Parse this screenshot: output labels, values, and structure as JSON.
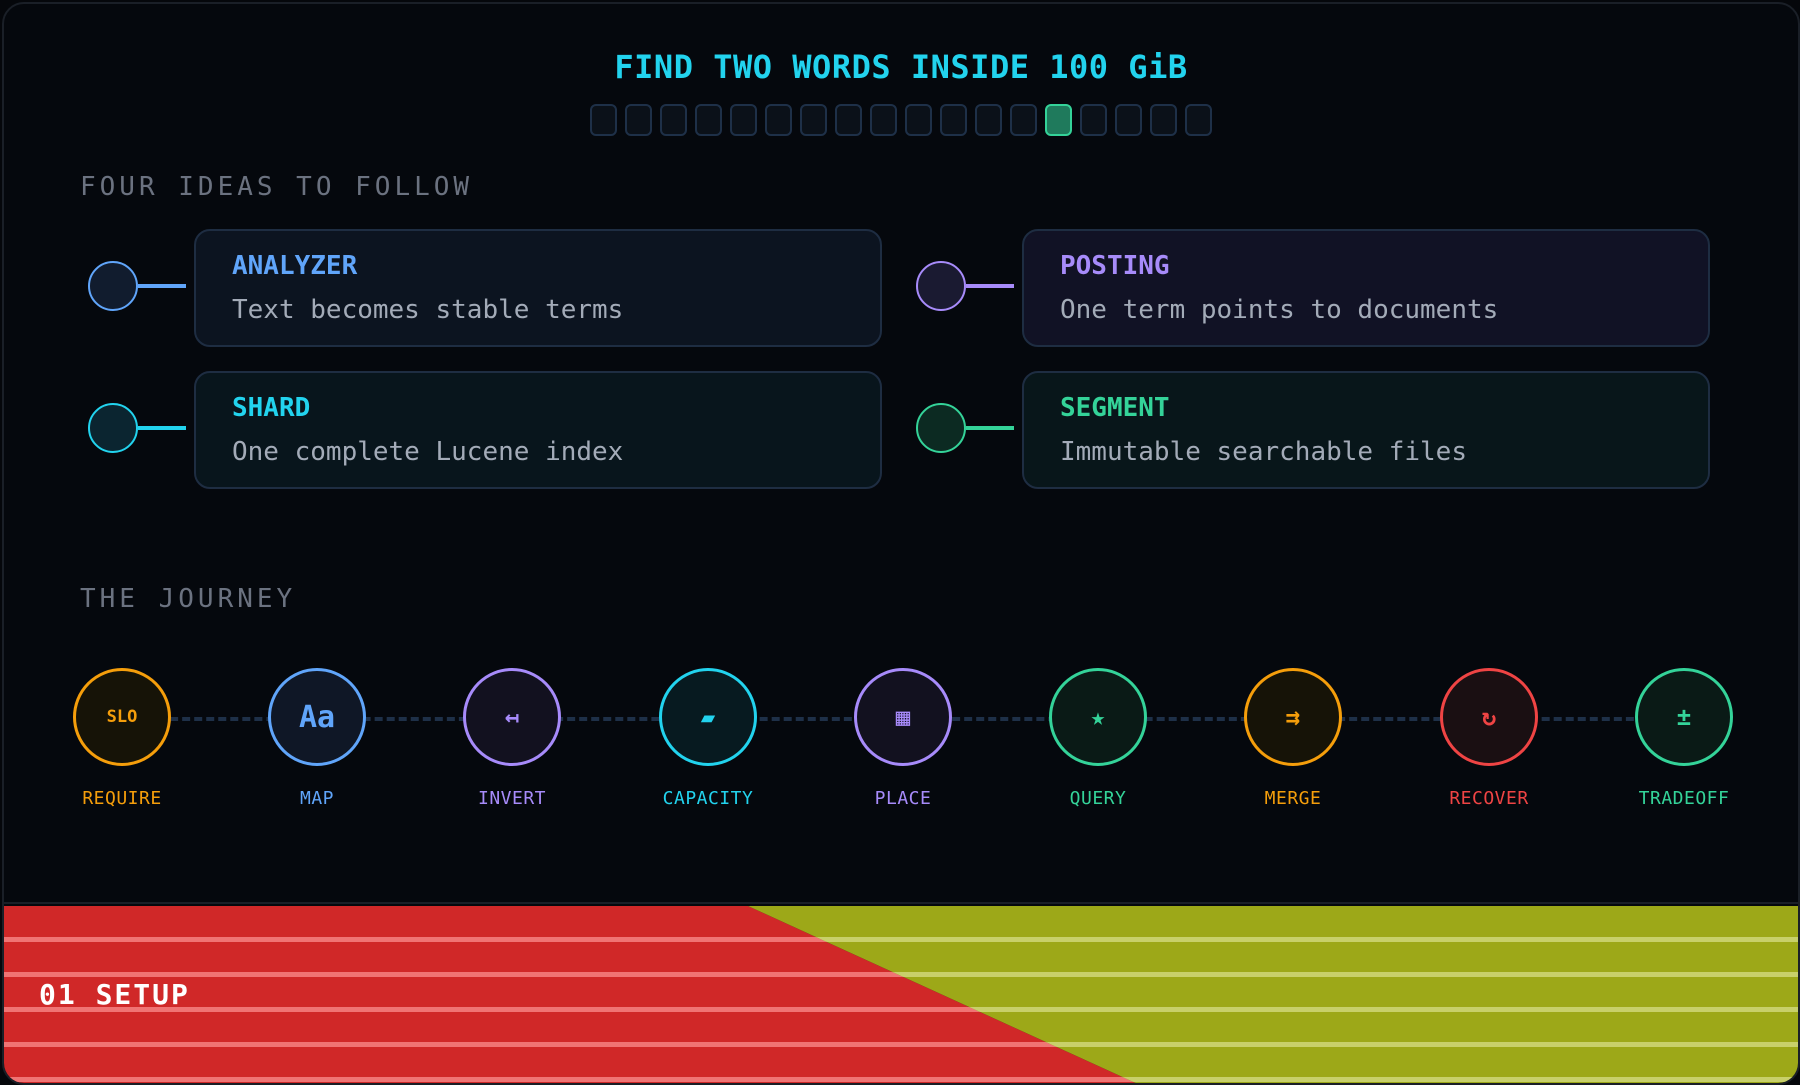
{
  "title": "FIND TWO WORDS INSIDE 100 GiB",
  "progress": {
    "total": 18,
    "active_index": 13
  },
  "concepts_section": {
    "label": "FOUR IDEAS TO FOLLOW",
    "items": [
      {
        "title": "ANALYZER",
        "desc": "Text becomes stable terms",
        "accent": "#60a5fa",
        "card_bg": "#0c1420",
        "node_bg": "#111c2e"
      },
      {
        "title": "POSTING",
        "desc": "One term points to documents",
        "accent": "#a78bfa",
        "card_bg": "#111225",
        "node_bg": "#1a1a31"
      },
      {
        "title": "SHARD",
        "desc": "One complete Lucene index",
        "accent": "#22d3ee",
        "card_bg": "#08151c",
        "node_bg": "#0b2530"
      },
      {
        "title": "SEGMENT",
        "desc": "Immutable searchable files",
        "accent": "#34d399",
        "card_bg": "#08161a",
        "node_bg": "#0c2a22"
      }
    ]
  },
  "journey": {
    "label": "THE JOURNEY",
    "steps": [
      {
        "label": "REQUIRE",
        "glyph": "SLO",
        "icon": "slo-icon",
        "color": "#f59e0b",
        "bg": "#161307"
      },
      {
        "label": "MAP",
        "glyph": "Aa",
        "icon": "text-case-icon",
        "color": "#60a5fa",
        "bg": "#0f1726"
      },
      {
        "label": "INVERT",
        "glyph": "↤",
        "icon": "arrow-left-bar-icon",
        "color": "#a78bfa",
        "bg": "#12111f"
      },
      {
        "label": "CAPACITY",
        "glyph": "▰",
        "icon": "parallelogram-icon",
        "color": "#22d3ee",
        "bg": "#071a20"
      },
      {
        "label": "PLACE",
        "glyph": "▦",
        "icon": "grid-icon",
        "color": "#a78bfa",
        "bg": "#12111f"
      },
      {
        "label": "QUERY",
        "glyph": "★",
        "icon": "star-icon",
        "color": "#34d399",
        "bg": "#0a1a16"
      },
      {
        "label": "MERGE",
        "glyph": "⇉",
        "icon": "double-arrow-right-icon",
        "color": "#f59e0b",
        "bg": "#161307"
      },
      {
        "label": "RECOVER",
        "glyph": "↻",
        "icon": "refresh-icon",
        "color": "#ef4444",
        "bg": "#1a0f12"
      },
      {
        "label": "TRADEOFF",
        "glyph": "±",
        "icon": "plus-minus-icon",
        "color": "#34d399",
        "bg": "#0a1a16"
      }
    ]
  },
  "footer": {
    "label": "01 SETUP",
    "left_color": "#d02828",
    "right_color": "#9da818"
  }
}
